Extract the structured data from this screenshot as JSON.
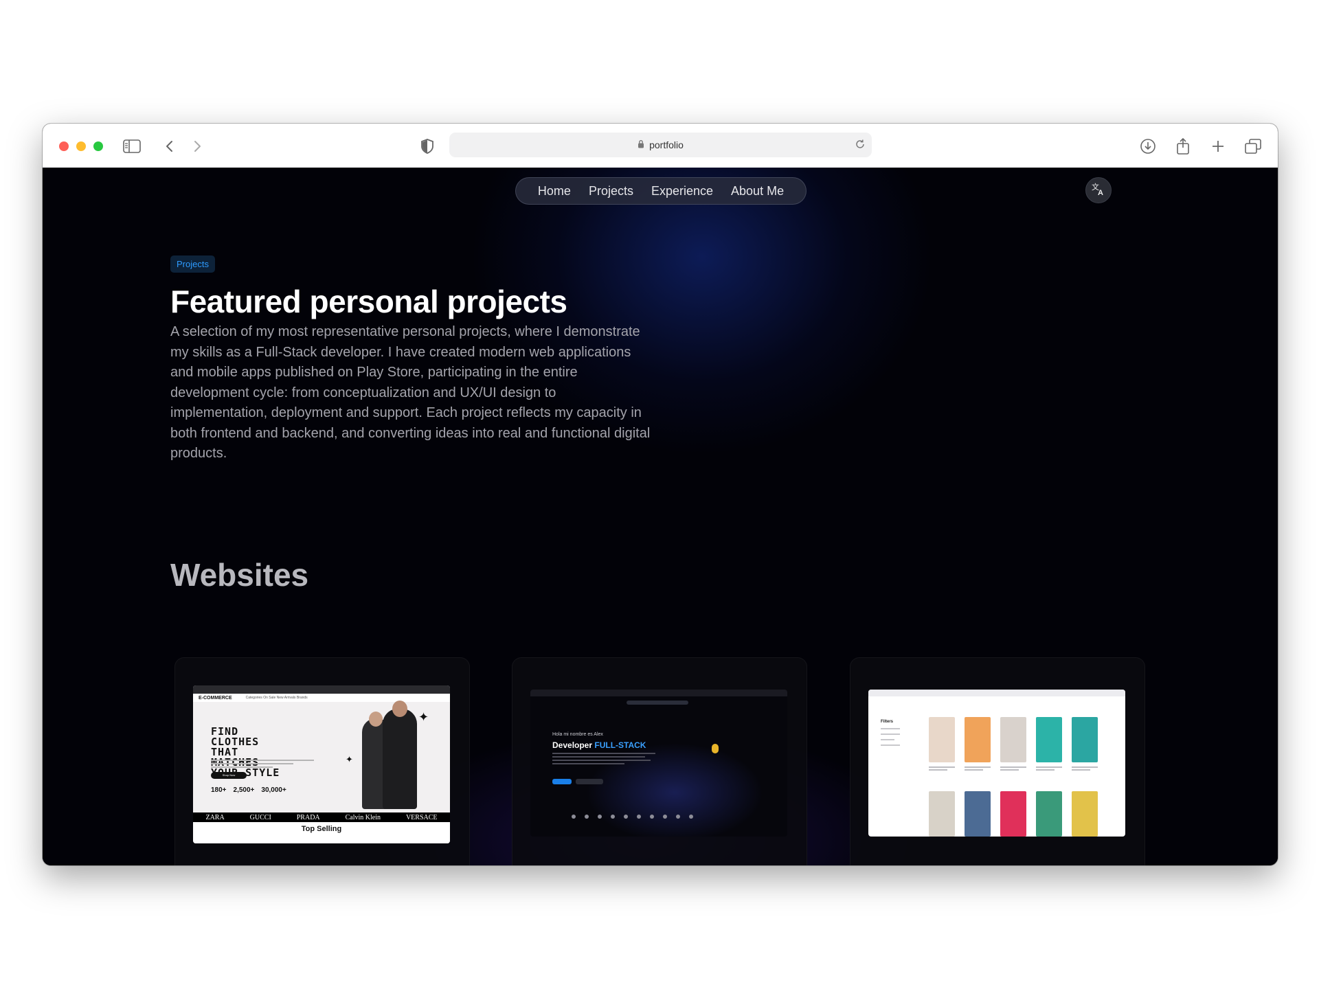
{
  "browser": {
    "address": "portfolio",
    "icons": [
      "sidebar-icon",
      "back-icon",
      "forward-icon",
      "shield-icon",
      "lock-icon",
      "reload-icon",
      "download-icon",
      "share-icon",
      "plus-icon",
      "tabs-icon"
    ]
  },
  "nav": {
    "items": [
      {
        "label": "Home"
      },
      {
        "label": "Projects"
      },
      {
        "label": "Experience"
      },
      {
        "label": "About Me"
      }
    ],
    "translate_icon": "translate-icon"
  },
  "hero": {
    "badge": "Projects",
    "title": "Featured personal projects",
    "description": "A selection of my most representative personal projects, where I demonstrate my skills as a Full-Stack developer. I have created modern web applications and mobile apps published on Play Store, participating in the entire development cycle: from conceptualization and UX/UI design to implementation, deployment and support. Each project reflects my capacity in both frontend and backend, and converting ideas into real and functional digital products."
  },
  "websites": {
    "title": "Websites",
    "cards": [
      {
        "ecommerce": {
          "brand": "E-COMMERCE",
          "nav_text": "Categories  On Sale  New Arrivals  Brands",
          "headline": "FIND CLOTHES THAT MATCHES YOUR STYLE",
          "button": "Shop Now",
          "stats": [
            "180+",
            "2,500+",
            "30,000+"
          ],
          "brands": [
            "ZARA",
            "GUCCI",
            "PRADA",
            "Calvin Klein",
            "VERSACE"
          ],
          "section": "Top Selling"
        }
      },
      {
        "portfolio": {
          "greeting": "Hola mi nombre es Alex",
          "role_prefix": "Developer",
          "role_highlight": "FULL-STACK"
        }
      },
      {
        "bookstore": {
          "filters": "Filters",
          "book_colors": [
            "#e8d7c9",
            "#f0a35a",
            "#d9d2cc",
            "#2cb3a8",
            "#2ba6a2",
            "#d8d2c8",
            "#4c6b94",
            "#e0305a",
            "#3a9a7a",
            "#e2c24a"
          ]
        }
      }
    ]
  },
  "colors": {
    "accent": "#2e9bff",
    "background": "#020208",
    "nav_bg": "#282c3c"
  }
}
